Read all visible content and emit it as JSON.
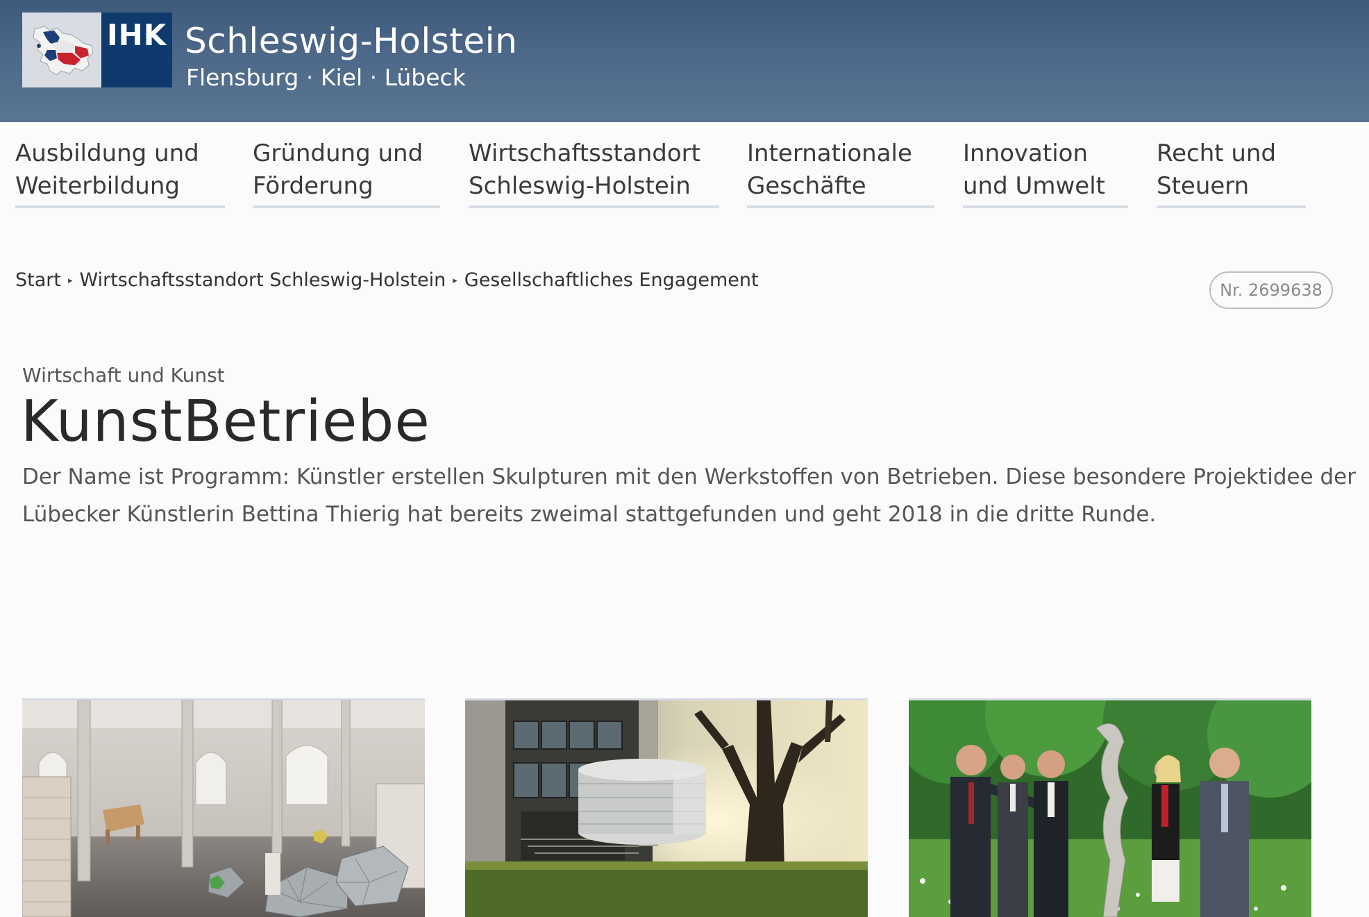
{
  "header": {
    "logo_text": "IHK",
    "title": "Schleswig-Holstein",
    "subtitle": "Flensburg · Kiel · Lübeck"
  },
  "nav": {
    "items": [
      {
        "line1": "Ausbildung und",
        "line2": "Weiterbildung"
      },
      {
        "line1": "Gründung und",
        "line2": "Förderung"
      },
      {
        "line1": "Wirtschaftsstandort",
        "line2": "Schleswig-Holstein"
      },
      {
        "line1": "Internationale",
        "line2": "Geschäfte"
      },
      {
        "line1": "Innovation",
        "line2": "und Umwelt"
      },
      {
        "line1": "Recht und",
        "line2": "Steuern"
      }
    ]
  },
  "breadcrumb": {
    "items": [
      "Start",
      "Wirtschaftsstandort Schleswig-Holstein",
      "Gesellschaftliches Engagement"
    ],
    "separator": "▸"
  },
  "document_number": "Nr. 2699638",
  "article": {
    "kicker": "Wirtschaft und Kunst",
    "title": "KunstBetriebe",
    "lead_line1": "Der Name ist Programm: Künstler erstellen Skulpturen mit den Werkstoffen von Betrieben. Diese besondere Projektidee der",
    "lead_line2": "Lübecker Künstlerin Bettina Thierig hat bereits zweimal stattgefunden und geht 2018 in die dritte Runde."
  },
  "colors": {
    "header_bg": "#4d6888",
    "logo_bg": "#0f3a6e",
    "nav_underline": "#d6dde6",
    "page_bg": "#fbfbfb"
  }
}
